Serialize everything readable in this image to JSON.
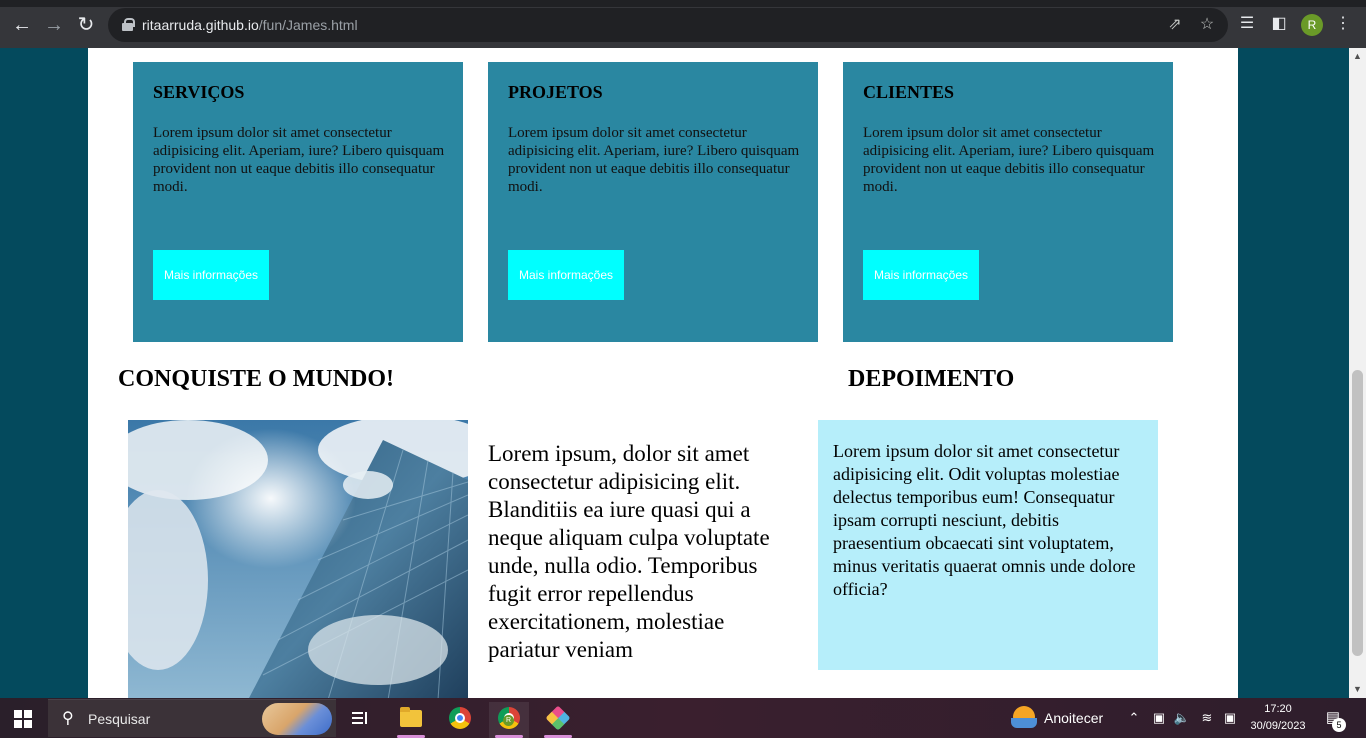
{
  "browser": {
    "url_host": "ritaarruda.github.io",
    "url_path": "/fun/James.html",
    "profile_initial": "R",
    "icons": [
      "back-icon",
      "forward-icon",
      "reload-icon",
      "lock-icon",
      "share-icon",
      "star-icon",
      "media-icon",
      "side-panel-icon",
      "menu-icon"
    ]
  },
  "cards": [
    {
      "title": "SERVIÇOS",
      "text": "Lorem ipsum dolor sit amet consectetur adipisicing elit. Aperiam, iure? Libero quisquam provident non ut eaque debitis illo consequatur modi.",
      "button": "Mais informações"
    },
    {
      "title": "PROJETOS",
      "text": "Lorem ipsum dolor sit amet consectetur adipisicing elit. Aperiam, iure? Libero quisquam provident non ut eaque debitis illo consequatur modi.",
      "button": "Mais informações"
    },
    {
      "title": "CLIENTES",
      "text": "Lorem ipsum dolor sit amet consectetur adipisicing elit. Aperiam, iure? Libero quisquam provident non ut eaque debitis illo consequatur modi.",
      "button": "Mais informações"
    }
  ],
  "conquiste": {
    "title": "CONQUISTE O MUNDO!",
    "text": "Lorem ipsum, dolor sit amet consectetur adipisicing elit. Blanditiis ea iure quasi qui a neque aliquam culpa voluptate unde, nulla odio. Temporibus fugit error repellendus exercitationem, molestiae pariatur veniam"
  },
  "depoimento": {
    "title": "DEPOIMENTO",
    "text": "Lorem ipsum dolor sit amet consectetur adipisicing elit. Odit voluptas molestiae delectus temporibus eum! Consequatur ipsam corrupti nesciunt, debitis praesentium obcaecati sint voluptatem, minus veritatis quaerat omnis unde dolore officia?"
  },
  "taskbar": {
    "search_placeholder": "Pesquisar",
    "weather": "Anoitecer",
    "time": "17:20",
    "date": "30/09/2023",
    "notification_count": "5",
    "chrome_badge": "R"
  },
  "colors": {
    "card_bg": "#2a87a1",
    "button_bg": "#00ffff",
    "testimonial_bg": "#b6eefa",
    "page_outer_bg": "#044a5d"
  }
}
